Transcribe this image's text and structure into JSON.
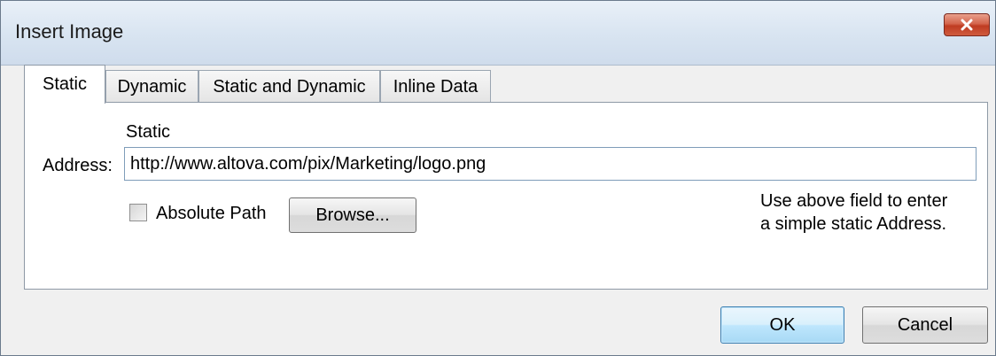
{
  "window": {
    "title": "Insert Image",
    "close_icon": "close-x-icon"
  },
  "tabs": [
    {
      "label": "Static",
      "active": true
    },
    {
      "label": "Dynamic",
      "active": false
    },
    {
      "label": "Static and Dynamic",
      "active": false
    },
    {
      "label": "Inline Data",
      "active": false
    }
  ],
  "static_panel": {
    "section_label": "Static",
    "address_label": "Address:",
    "address_value": "http://www.altova.com/pix/Marketing/logo.png",
    "absolute_path_label": "Absolute Path",
    "absolute_path_checked": false,
    "browse_label": "Browse...",
    "hint_line1": "Use above field to enter",
    "hint_line2": "a simple static Address."
  },
  "footer": {
    "ok_label": "OK",
    "cancel_label": "Cancel"
  }
}
